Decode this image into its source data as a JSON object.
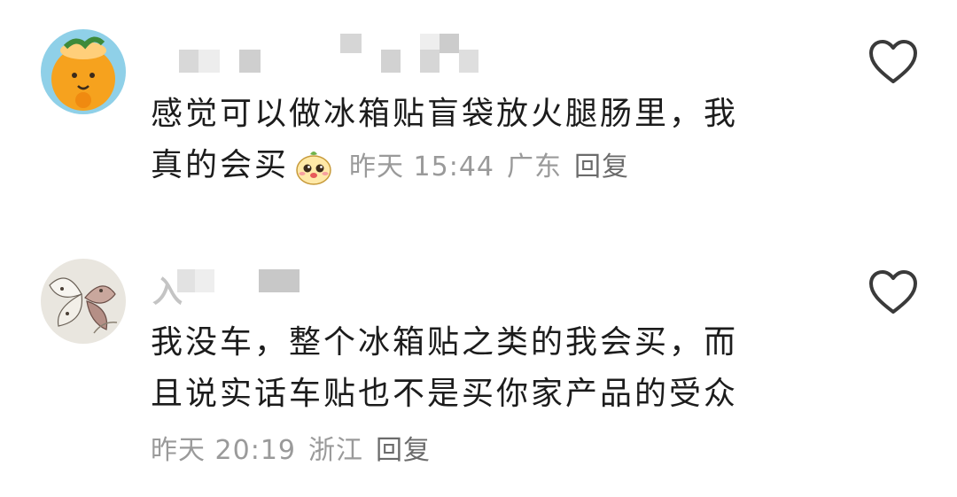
{
  "comments": [
    {
      "avatar_icon": "orange-cartoon-avatar",
      "username_masked": true,
      "text_line1": "感觉可以做冰箱贴盲袋放火腿肠里，我",
      "text_line2": "真的会买",
      "emoji_icon": "cute-mascot-emoji",
      "time": "昨天 15:44",
      "location": "广东",
      "reply_label": "回复",
      "like_icon": "heart-outline-icon"
    },
    {
      "avatar_icon": "butterfly-photo-avatar",
      "username_masked": true,
      "username_partial": "入",
      "text_line1": "我没车，整个冰箱贴之类的我会买，而",
      "text_line2": "且说实话车贴也不是买你家产品的受众",
      "time": "昨天 20:19",
      "location": "浙江",
      "reply_label": "回复",
      "like_icon": "heart-outline-icon"
    }
  ],
  "colors": {
    "text": "#1c1c1c",
    "meta": "#9a9a9a",
    "reply": "#6b6b6b",
    "heart_stroke": "#3a3a3a"
  }
}
